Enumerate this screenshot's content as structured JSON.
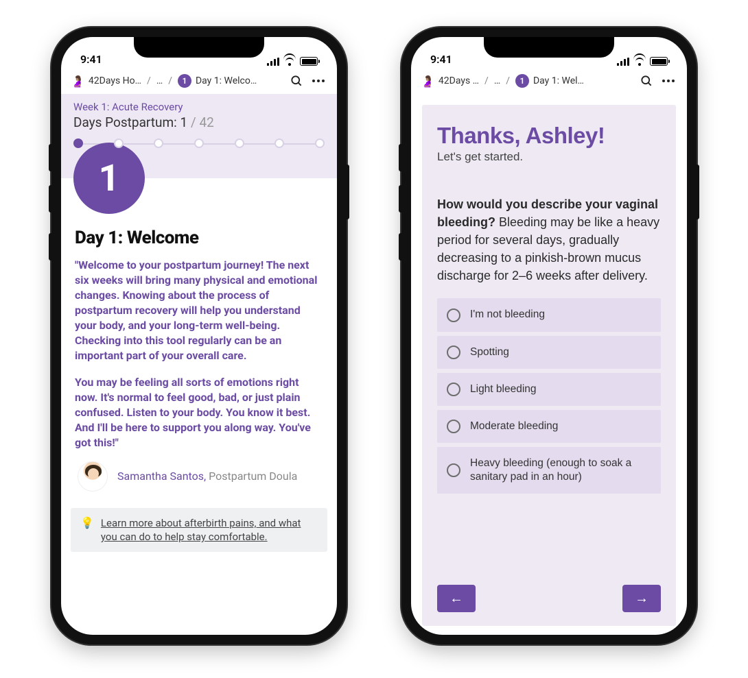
{
  "statusbar": {
    "time": "9:41"
  },
  "colors": {
    "accent": "#6b4ba3",
    "accent_light": "#eee8f5",
    "option_bg": "#e4dcee"
  },
  "phone1": {
    "nav": {
      "app_icon": "🤰🏽",
      "crumb1": "42Days Ho…",
      "crumb_sep": "/",
      "crumb_mid": "…",
      "crumb_badge": "1",
      "crumb_last": "Day 1: Welco…"
    },
    "header": {
      "week_label": "Week 1: Acute Recovery",
      "days_label": "Days Postpartum:",
      "days_current": "1",
      "days_total": "/ 42",
      "step_count": 7,
      "step_active_index": 0,
      "big_number": "1"
    },
    "title": "Day 1: Welcome",
    "quote1": "\"Welcome to your postpartum journey! The next six weeks will bring many physical and emotional changes. Knowing about the process of postpartum recovery will help you understand your body, and your long-term well-being. Checking into this tool regularly can be an important part of your overall care.",
    "quote2": "You may be feeling all sorts of emotions right now. It's normal to feel good, bad, or just plain confused. Listen to your body. You know it best. And I'll be here to support you along way. You've got this!\"",
    "author_name": "Samantha Santos,",
    "author_role": " Postpartum Doula",
    "tip_icon": "💡",
    "tip_text": "Learn more about afterbirth pains, and what you can do to help stay comfortable."
  },
  "phone2": {
    "nav": {
      "app_icon": "🤰🏽",
      "crumb1": "42Days …",
      "crumb_sep": "/",
      "crumb_mid": "…",
      "crumb_badge": "1",
      "crumb_last": "Day 1: Wel…"
    },
    "heading": "Thanks, Ashley!",
    "subheading": "Let's get started.",
    "question_bold": "How would you describe your vaginal bleeding?",
    "question_rest": " Bleeding may be like a heavy period for several days, gradually decreasing to a pinkish-brown mucus discharge for 2–6 weeks after delivery.",
    "options": [
      "I'm not bleeding",
      "Spotting",
      "Light bleeding",
      "Moderate bleeding",
      "Heavy bleeding (enough to soak a sanitary pad in an hour)"
    ],
    "prev_label": "←",
    "next_label": "→"
  }
}
